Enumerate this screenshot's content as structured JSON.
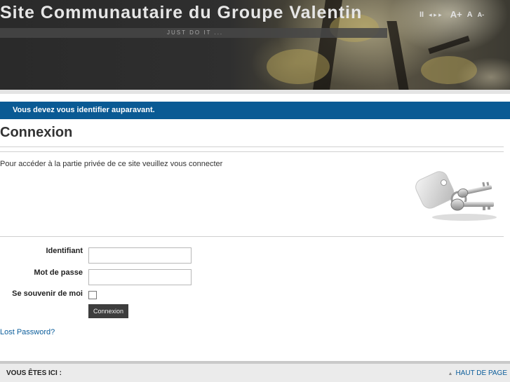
{
  "header": {
    "site_title": "Site Communautaire du Groupe Valentin",
    "tagline": "JUST DO IT ...",
    "tools": {
      "pause": "II",
      "prev_next": "◂ ▸ ▸",
      "font_large": "A+",
      "font_normal": "A",
      "font_small": "A-"
    }
  },
  "notice": {
    "message": "Vous devez vous identifier auparavant."
  },
  "main": {
    "title": "Connexion",
    "intro": "Pour accéder à la partie privée de ce site veuillez vous connecter",
    "keys_icon": "keys-icon"
  },
  "form": {
    "username_label": "Identifiant",
    "username_value": "",
    "password_label": "Mot de passe",
    "password_value": "",
    "remember_label": "Se souvenir de moi",
    "remember_checked": false,
    "submit_label": "Connexion",
    "lost_password": "Lost Password?"
  },
  "footer": {
    "breadcrumb_label": "VOUS ÊTES ICI :",
    "top_link": "HAUT DE PAGE",
    "top_arrow": "▲"
  },
  "colors": {
    "notice_bg": "#0a5a94",
    "link": "#0b5d9b",
    "button_bg": "#3d3d3d"
  }
}
